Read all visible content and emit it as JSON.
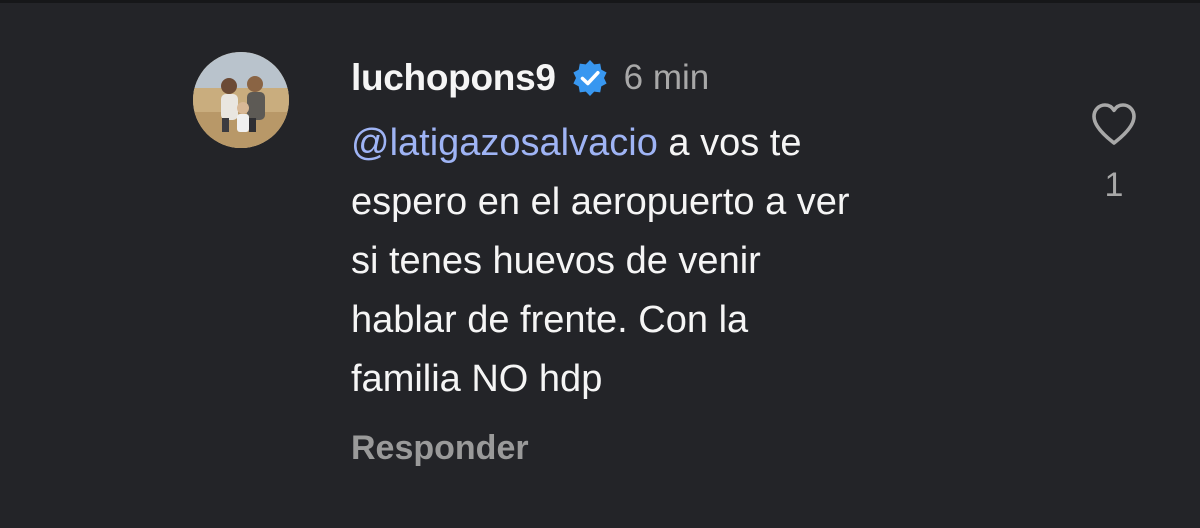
{
  "comment": {
    "username": "luchopons9",
    "time": "6 min",
    "mention": "@latigazosalvacio",
    "text_lines": [
      " a vos te",
      "espero en el aeropuerto a ver",
      "si tenes huevos de venir",
      "hablar de frente. Con la",
      "familia NO hdp"
    ],
    "reply_label": "Responder",
    "like_count": "1"
  },
  "icons": {
    "verified": "verified-badge-icon",
    "like": "heart-outline-icon",
    "avatar": "profile-photo"
  },
  "colors": {
    "background": "#232428",
    "mention": "#9fb4f5",
    "verified_badge": "#3897f0",
    "muted_text": "#a8a8a8"
  }
}
